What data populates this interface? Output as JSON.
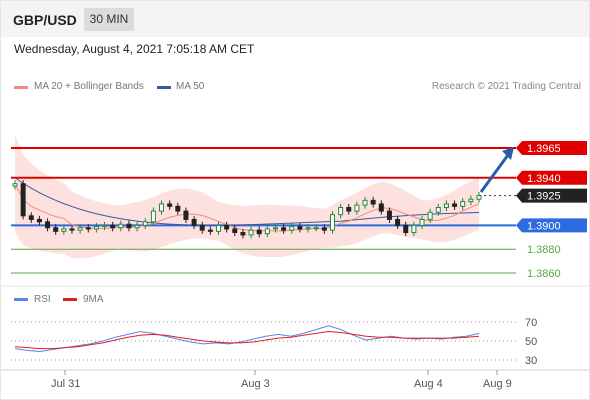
{
  "header": {
    "symbol": "GBP/USD",
    "timeframe": "30 MIN"
  },
  "datetime": "Wednesday, August 4, 2021 7:05:18 AM CET",
  "legend": {
    "ma20": "MA 20 + Bollinger Bands",
    "ma50": "MA 50",
    "rsi": "RSI",
    "ma9": "9MA"
  },
  "credit": "Research © 2021 Trading Central",
  "colors": {
    "ma20": "#f08a80",
    "ma50": "#3b5a9a",
    "rsi": "#5b86e0",
    "ma9": "#e02020",
    "resistance": "#e00000",
    "support": "#2d6be0",
    "target": "#5aa646",
    "bullish": "#1f8a3a",
    "bearish": "#222222",
    "bollinger": "#fde1de",
    "arrow": "#2a5cad"
  },
  "chart_data": {
    "type": "candlestick",
    "x_labels": [
      "Jul 31",
      "Aug 3",
      "Aug 4",
      "Aug 9"
    ],
    "price_levels": [
      {
        "value": 1.3965,
        "label": "1.3965",
        "kind": "resistance"
      },
      {
        "value": 1.394,
        "label": "1.3940",
        "kind": "resistance"
      },
      {
        "value": 1.3925,
        "label": "1.3925",
        "kind": "current"
      },
      {
        "value": 1.39,
        "label": "1.3900",
        "kind": "pivot"
      },
      {
        "value": 1.388,
        "label": "1.3880",
        "kind": "target"
      },
      {
        "value": 1.386,
        "label": "1.3860",
        "kind": "target"
      }
    ],
    "price_close": [
      1.3935,
      1.3908,
      1.3905,
      1.3903,
      1.3898,
      1.3895,
      1.3897,
      1.3896,
      1.3898,
      1.3897,
      1.3899,
      1.39,
      1.3898,
      1.3901,
      1.3898,
      1.39,
      1.3903,
      1.3912,
      1.3918,
      1.3916,
      1.3912,
      1.3905,
      1.39,
      1.3896,
      1.3895,
      1.39,
      1.3897,
      1.3894,
      1.3892,
      1.3896,
      1.3893,
      1.3897,
      1.3898,
      1.3896,
      1.3899,
      1.3897,
      1.3898,
      1.3898,
      1.3896,
      1.3909,
      1.3915,
      1.3912,
      1.3917,
      1.3921,
      1.3918,
      1.3912,
      1.3905,
      1.39,
      1.3894,
      1.39,
      1.3905,
      1.3911,
      1.3915,
      1.3918,
      1.3916,
      1.392,
      1.3922,
      1.3925
    ],
    "rsi": [
      42,
      40,
      39,
      41,
      43,
      45,
      47,
      50,
      54,
      57,
      60,
      58,
      55,
      52,
      49,
      47,
      48,
      47,
      49,
      52,
      55,
      57,
      55,
      58,
      62,
      66,
      62,
      56,
      51,
      53,
      55,
      53,
      52,
      53,
      52,
      54,
      55,
      58
    ],
    "rsi_ma9": [
      44,
      43,
      42,
      42,
      43,
      44,
      46,
      48,
      51,
      54,
      56,
      57,
      56,
      54,
      52,
      50,
      49,
      48,
      48,
      49,
      51,
      53,
      54,
      56,
      58,
      60,
      59,
      57,
      55,
      54,
      54,
      53,
      53,
      53,
      53,
      53,
      54,
      55
    ],
    "rsi_levels": [
      70,
      50,
      30
    ]
  }
}
